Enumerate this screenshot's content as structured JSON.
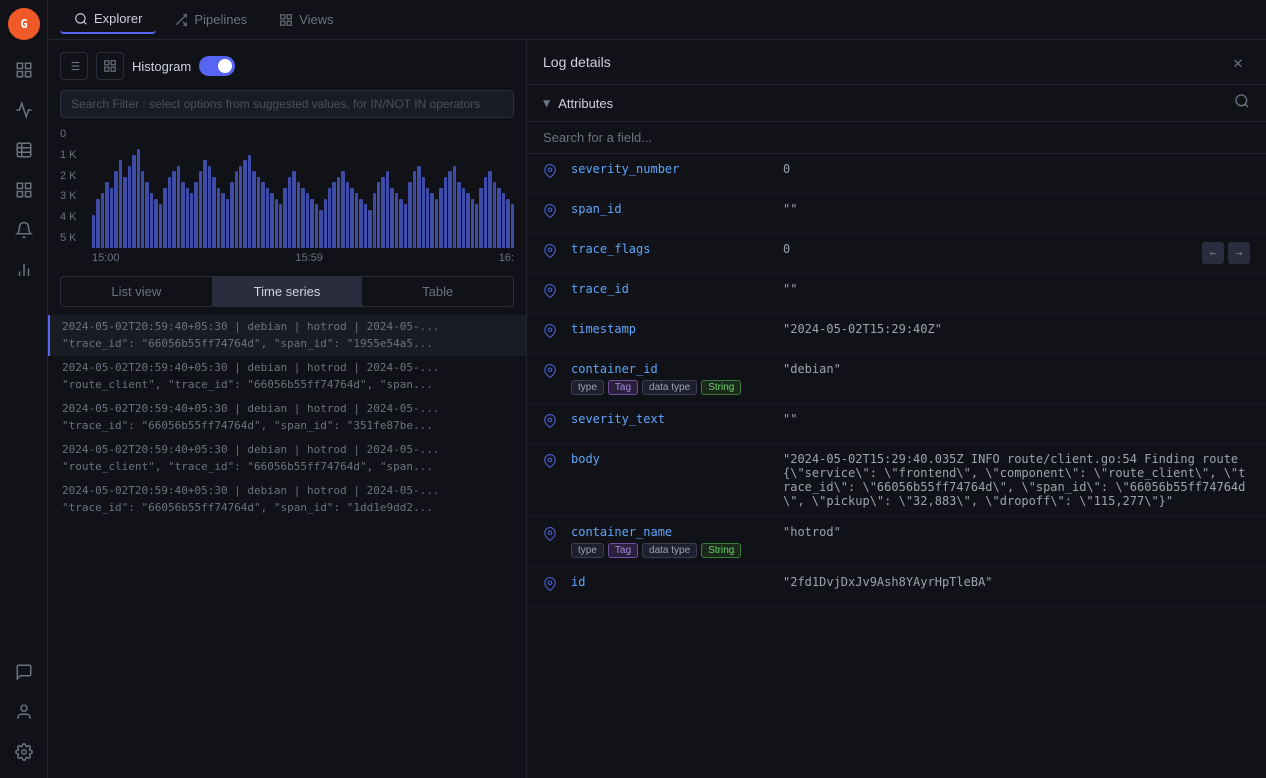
{
  "sidebar": {
    "logo": "G",
    "icons": [
      "chart-bar",
      "activity",
      "table",
      "grid",
      "bell",
      "chart-line",
      "clipboard"
    ]
  },
  "nav": {
    "tabs": [
      {
        "label": "Explorer",
        "icon": "⬡",
        "active": true
      },
      {
        "label": "Pipelines",
        "icon": "⇄",
        "active": false
      },
      {
        "label": "Views",
        "icon": "⊞",
        "active": false
      }
    ]
  },
  "explorer": {
    "histogram_label": "Histogram",
    "histogram_enabled": true,
    "search_placeholder": "Search Filter : select options from suggested values, for IN/NOT IN operators",
    "y_axis_labels": [
      "5 K",
      "4 K",
      "3 K",
      "2 K",
      "1 K",
      "0"
    ],
    "x_axis_labels": [
      "15:00",
      "15:59",
      "16:"
    ],
    "view_tabs": [
      {
        "label": "List view",
        "active": false
      },
      {
        "label": "Time series",
        "active": true
      },
      {
        "label": "Table",
        "active": false
      }
    ],
    "log_entries": [
      {
        "lines": [
          "2024-05-02T20:59:40+05:30 | debian | hotrod | 2024-05-...",
          "\"trace_id\": \"66056b55ff74764d\", \"span_id\": \"1955e54a5..."
        ]
      },
      {
        "lines": [
          "2024-05-02T20:59:40+05:30 | debian | hotrod | 2024-05-...",
          "\"route_client\", \"trace_id\": \"66056b55ff74764d\", \"span..."
        ]
      },
      {
        "lines": [
          "2024-05-02T20:59:40+05:30 | debian | hotrod | 2024-05-...",
          "\"trace_id\": \"66056b55ff74764d\", \"span_id\": \"351fe87be..."
        ]
      },
      {
        "lines": [
          "2024-05-02T20:59:40+05:30 | debian | hotrod | 2024-05-...",
          "\"route_client\", \"trace_id\": \"66056b55ff74764d\", \"span..."
        ]
      },
      {
        "lines": [
          "2024-05-02T20:59:40+05:30 | debian | hotrod | 2024-05-...",
          "\"trace_id\": \"66056b55ff74764d\", \"span_id\": \"1dd1e9dd2..."
        ]
      }
    ]
  },
  "log_details": {
    "title": "Log details",
    "attributes_section_label": "Attributes",
    "search_placeholder": "Search for a field...",
    "attributes": [
      {
        "name": "severity_number",
        "value": "0",
        "tags": [],
        "has_actions": false
      },
      {
        "name": "span_id",
        "value": "\"\"",
        "tags": [],
        "has_actions": false
      },
      {
        "name": "trace_flags",
        "value": "0",
        "tags": [],
        "has_actions": true
      },
      {
        "name": "trace_id",
        "value": "\"\"",
        "tags": [],
        "has_actions": false
      },
      {
        "name": "timestamp",
        "value": "\"2024-05-02T15:29:40Z\"",
        "tags": [],
        "has_actions": false
      },
      {
        "name": "container_id",
        "value": "\"debian\"",
        "tags": [
          {
            "label": "type",
            "type": "plain"
          },
          {
            "label": "Tag",
            "type": "tag"
          },
          {
            "label": "data type",
            "type": "plain"
          },
          {
            "label": "String",
            "type": "string"
          }
        ],
        "has_actions": false
      },
      {
        "name": "severity_text",
        "value": "\"\"",
        "tags": [],
        "has_actions": false
      },
      {
        "name": "body",
        "value": "\"2024-05-02T15:29:40.035Z INFO route/client.go:54 Finding route {\\\"service\\\": \\\"frontend\\\", \\\"component\\\": \\\"route_client\\\", \\\"trace_id\\\": \\\"66056b55ff74764d\\\", \\\"span_id\\\": \\\"66056b55ff74764d\\\", \\\"pickup\\\": \\\"32,883\\\", \\\"dropoff\\\": \\\"115,277\\\"}\"",
        "tags": [],
        "has_actions": false
      },
      {
        "name": "container_name",
        "value": "\"hotrod\"",
        "tags": [
          {
            "label": "type",
            "type": "plain"
          },
          {
            "label": "Tag",
            "type": "tag"
          },
          {
            "label": "data type",
            "type": "plain"
          },
          {
            "label": "String",
            "type": "string"
          }
        ],
        "has_actions": false
      },
      {
        "name": "id",
        "value": "\"2fd1DvjDxJv9Ash8YAyrHpTleBА\"",
        "tags": [],
        "has_actions": false
      }
    ],
    "bar_heights_percent": [
      30,
      45,
      50,
      60,
      55,
      70,
      80,
      65,
      75,
      85,
      90,
      70,
      60,
      50,
      45,
      40,
      55,
      65,
      70,
      75,
      60,
      55,
      50,
      60,
      70,
      80,
      75,
      65,
      55,
      50,
      45,
      60,
      70,
      75,
      80,
      85,
      70,
      65,
      60,
      55,
      50,
      45,
      40,
      55,
      65,
      70,
      60,
      55,
      50,
      45,
      40,
      35,
      45,
      55,
      60,
      65,
      70,
      60,
      55,
      50,
      45,
      40,
      35,
      50,
      60,
      65,
      70,
      55,
      50,
      45,
      40,
      60,
      70,
      75,
      65,
      55,
      50,
      45,
      55,
      65,
      70,
      75,
      60,
      55,
      50,
      45,
      40,
      55,
      65,
      70,
      60,
      55,
      50,
      45,
      40
    ]
  }
}
